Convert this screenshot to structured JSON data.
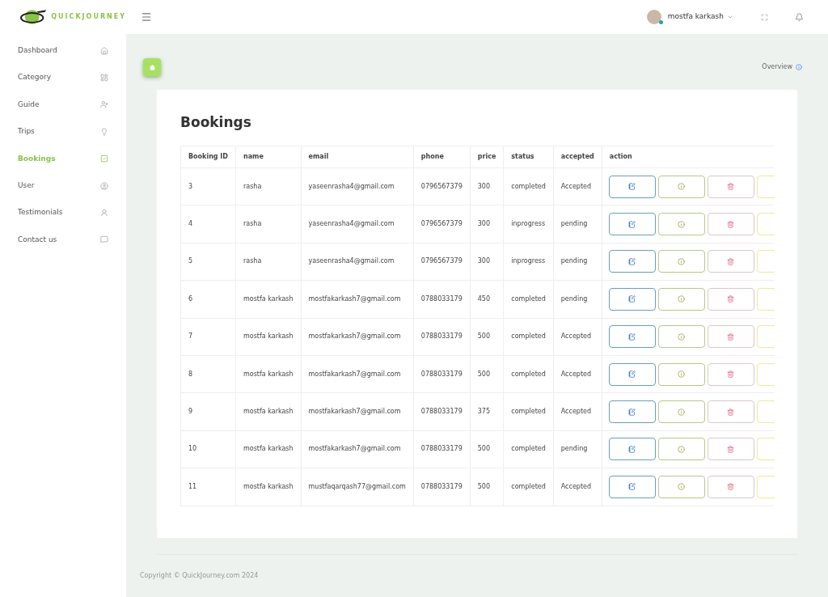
{
  "brand": {
    "name": "QUICKJOURNEY"
  },
  "sidebar": {
    "items": [
      {
        "label": "Dashboard",
        "selected": false
      },
      {
        "label": "Category",
        "selected": false
      },
      {
        "label": "Guide",
        "selected": false
      },
      {
        "label": "Trips",
        "selected": false
      },
      {
        "label": "Bookings",
        "selected": true
      },
      {
        "label": "User",
        "selected": false
      },
      {
        "label": "Testimonials",
        "selected": false
      },
      {
        "label": "Contact us",
        "selected": false
      }
    ]
  },
  "header": {
    "user_name": "mostfa karkash",
    "online": true
  },
  "breadcrumb": {
    "overview": "Overview"
  },
  "page": {
    "title": "Bookings"
  },
  "table": {
    "columns": [
      "Booking ID",
      "name",
      "email",
      "phone",
      "price",
      "status",
      "accepted",
      "action"
    ],
    "rows": [
      [
        "3",
        "rasha",
        "yaseenrasha4@gmail.com",
        "0796567379",
        "300",
        "completed",
        "Accepted"
      ],
      [
        "4",
        "rasha",
        "yaseenrasha4@gmail.com",
        "0796567379",
        "300",
        "inprogress",
        "pending"
      ],
      [
        "5",
        "rasha",
        "yaseenrasha4@gmail.com",
        "0796567379",
        "300",
        "inprogress",
        "pending"
      ],
      [
        "6",
        "mostfa karkash",
        "mostfakarkash7@gmail.com",
        "0788033179",
        "450",
        "completed",
        "pending"
      ],
      [
        "7",
        "mostfa karkash",
        "mostfakarkash7@gmail.com",
        "0788033179",
        "500",
        "completed",
        "Accepted"
      ],
      [
        "8",
        "mostfa karkash",
        "mostfakarkash7@gmail.com",
        "0788033179",
        "500",
        "completed",
        "Accepted"
      ],
      [
        "9",
        "mostfa karkash",
        "mostfakarkash7@gmail.com",
        "0788033179",
        "375",
        "completed",
        "Accepted"
      ],
      [
        "10",
        "mostfa karkash",
        "mostfakarkash7@gmail.com",
        "0788033179",
        "500",
        "completed",
        "pending"
      ],
      [
        "11",
        "mostfa karkash",
        "mustfaqarqash77@gmail.com",
        "0788033179",
        "500",
        "completed",
        "Accepted"
      ]
    ]
  },
  "footer": {
    "copyright": "Copyright © QuickJourney.com 2024"
  }
}
